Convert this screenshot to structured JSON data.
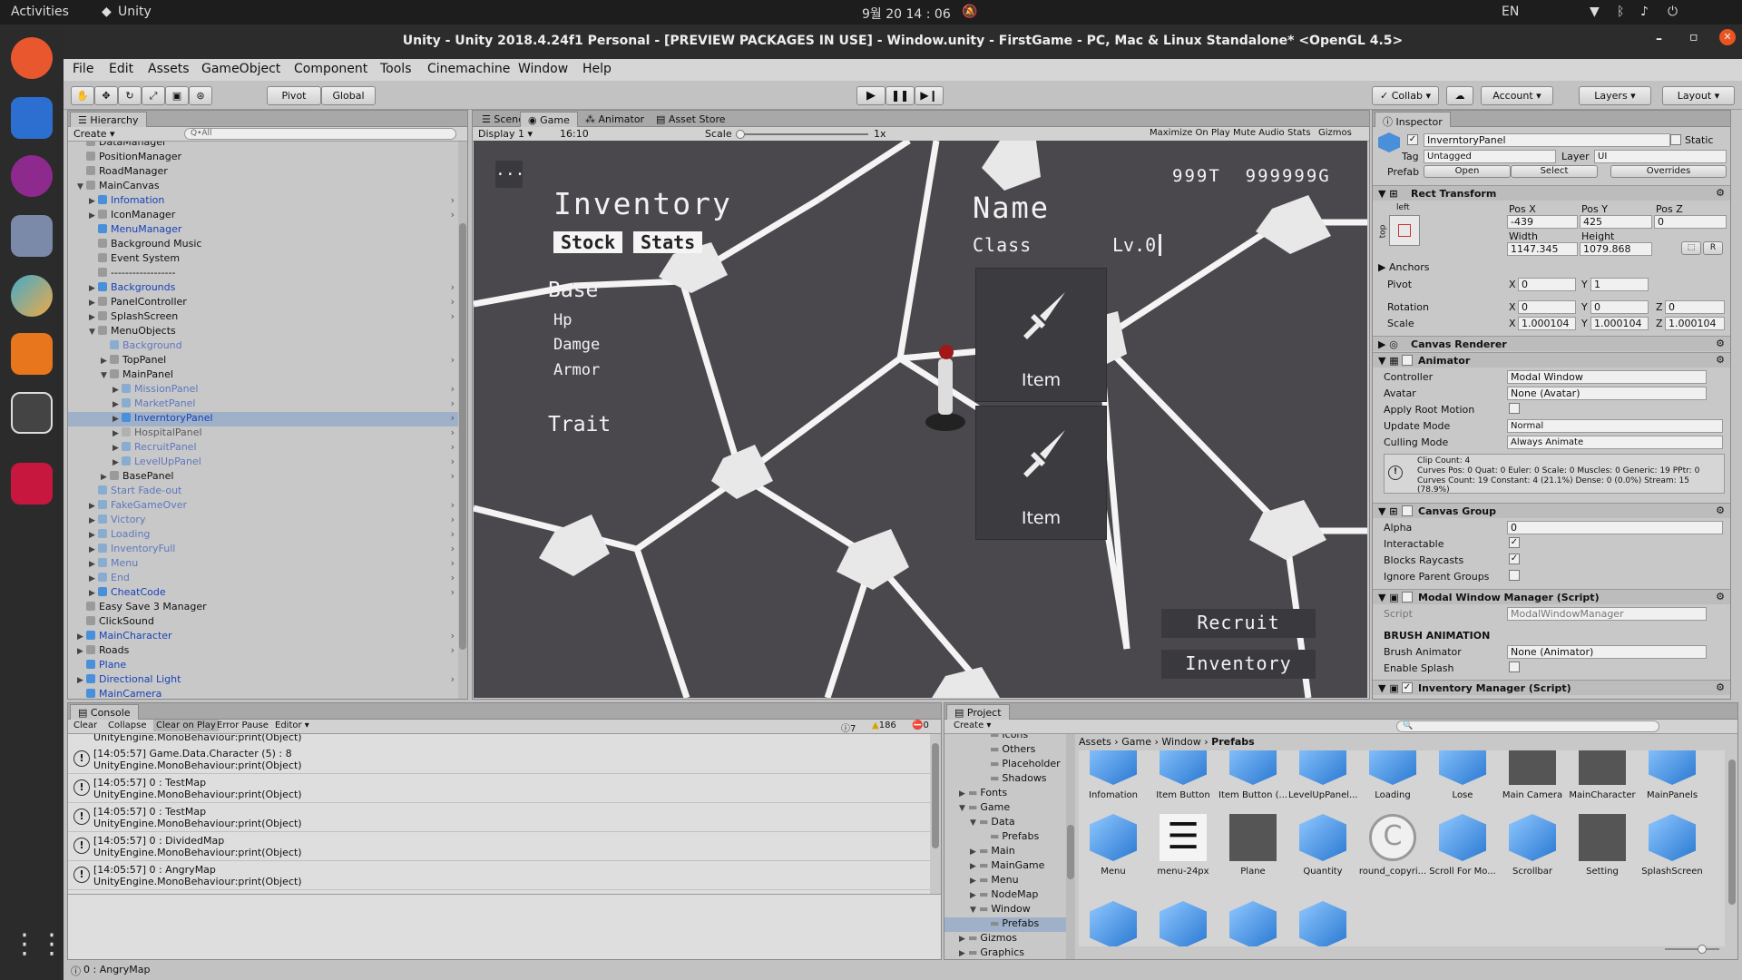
{
  "system": {
    "activities": "Activities",
    "app": "Unity",
    "clock": "9월 20  14 : 06",
    "lang": "EN"
  },
  "window": {
    "title": "Unity - Unity 2018.4.24f1 Personal - [PREVIEW PACKAGES IN USE] - Window.unity - FirstGame - PC, Mac & Linux Standalone* <OpenGL 4.5>"
  },
  "menu": [
    "File",
    "Edit",
    "Assets",
    "GameObject",
    "Component",
    "Tools",
    "Cinemachine",
    "Window",
    "Help"
  ],
  "toolbar": {
    "pivot": "Pivot",
    "global": "Global",
    "collab": "Collab",
    "account": "Account",
    "layers": "Layers",
    "layout": "Layout"
  },
  "hierarchy": {
    "tab": "Hierarchy",
    "create": "Create",
    "search": "Q•All",
    "items": [
      {
        "label": "DataManager",
        "indent": 1,
        "blue": false
      },
      {
        "label": "PositionManager",
        "indent": 1,
        "blue": false
      },
      {
        "label": "RoadManager",
        "indent": 1,
        "blue": false
      },
      {
        "label": "MainCanvas",
        "indent": 1,
        "blue": false,
        "open": true
      },
      {
        "label": "Infomation",
        "indent": 2,
        "blue": true,
        "arrow": true
      },
      {
        "label": "IconManager",
        "indent": 2,
        "blue": false,
        "arrow": true
      },
      {
        "label": "MenuManager",
        "indent": 2,
        "blue": true
      },
      {
        "label": "Background Music",
        "indent": 2,
        "blue": false
      },
      {
        "label": "Event System",
        "indent": 2,
        "blue": false
      },
      {
        "label": "------------------",
        "indent": 2,
        "blue": false
      },
      {
        "label": "Backgrounds",
        "indent": 2,
        "blue": true,
        "arrow": true
      },
      {
        "label": "PanelController",
        "indent": 2,
        "blue": false,
        "arrow": true
      },
      {
        "label": "SplashScreen",
        "indent": 2,
        "blue": false,
        "arrow": true
      },
      {
        "label": "MenuObjects",
        "indent": 2,
        "blue": false,
        "open": true
      },
      {
        "label": "Background",
        "indent": 3,
        "blue": true,
        "faded": true
      },
      {
        "label": "TopPanel",
        "indent": 3,
        "blue": false,
        "arrow": true
      },
      {
        "label": "MainPanel",
        "indent": 3,
        "blue": false,
        "open": true
      },
      {
        "label": "MissionPanel",
        "indent": 4,
        "blue": true,
        "faded": true,
        "arrow": true
      },
      {
        "label": "MarketPanel",
        "indent": 4,
        "blue": true,
        "faded": true,
        "arrow": true
      },
      {
        "label": "InverntoryPanel",
        "indent": 4,
        "blue": true,
        "selected": true,
        "arrow": true
      },
      {
        "label": "HospitalPanel",
        "indent": 4,
        "blue": false,
        "faded": true,
        "arrow": true
      },
      {
        "label": "RecruitPanel",
        "indent": 4,
        "blue": true,
        "faded": true,
        "arrow": true
      },
      {
        "label": "LevelUpPanel",
        "indent": 4,
        "blue": true,
        "faded": true,
        "arrow": true
      },
      {
        "label": "BasePanel",
        "indent": 3,
        "blue": false,
        "arrow": true
      },
      {
        "label": "Start Fade-out",
        "indent": 2,
        "blue": true,
        "faded": true
      },
      {
        "label": "FakeGameOver",
        "indent": 2,
        "blue": true,
        "faded": true,
        "arrow": true
      },
      {
        "label": "Victory",
        "indent": 2,
        "blue": true,
        "faded": true,
        "arrow": true
      },
      {
        "label": "Loading",
        "indent": 2,
        "blue": true,
        "faded": true,
        "arrow": true
      },
      {
        "label": "InventoryFull",
        "indent": 2,
        "blue": true,
        "faded": true,
        "arrow": true
      },
      {
        "label": "Menu",
        "indent": 2,
        "blue": true,
        "faded": true,
        "arrow": true
      },
      {
        "label": "End",
        "indent": 2,
        "blue": true,
        "faded": true,
        "arrow": true
      },
      {
        "label": "CheatCode",
        "indent": 2,
        "blue": true,
        "arrow": true
      },
      {
        "label": "Easy Save 3 Manager",
        "indent": 1,
        "blue": false
      },
      {
        "label": "ClickSound",
        "indent": 1,
        "blue": false
      },
      {
        "label": "MainCharacter",
        "indent": 1,
        "blue": true,
        "arrow": true
      },
      {
        "label": "Roads",
        "indent": 1,
        "blue": false,
        "arrow": true
      },
      {
        "label": "Plane",
        "indent": 1,
        "blue": true
      },
      {
        "label": "Directional Light",
        "indent": 1,
        "blue": true,
        "arrow": true
      },
      {
        "label": "MainCamera",
        "indent": 1,
        "blue": true
      }
    ]
  },
  "scene": {
    "tabs": [
      "Scene",
      "Game",
      "Animator",
      "Asset Store"
    ],
    "display": "Display 1",
    "aspect": "16:10",
    "scale_label": "Scale",
    "scale_value": "1x",
    "maximize": "Maximize On Play",
    "mute": "Mute Audio",
    "stats": "Stats",
    "gizmos": "Gizmos"
  },
  "game": {
    "menu": "...",
    "title": "Inventory",
    "stock": "Stock",
    "stats": "Stats",
    "base": "Base",
    "hp": "Hp",
    "damge": "Damge",
    "armor": "Armor",
    "trait": "Trait",
    "name": "Name",
    "class": "Class",
    "lv": "Lv.0",
    "currency": "999T  999999G",
    "item1": "Item",
    "item2": "Item",
    "recruit": "Recruit",
    "inventory": "Inventory"
  },
  "inspector": {
    "tab": "Inspector",
    "name": "InverntoryPanel",
    "static": "Static",
    "tag_label": "Tag",
    "tag": "Untagged",
    "layer_label": "Layer",
    "layer": "UI",
    "prefab": "Prefab",
    "open": "Open",
    "select": "Select",
    "overrides": "Overrides",
    "rect": {
      "title": "Rect Transform",
      "left": "left",
      "top": "top",
      "posx_l": "Pos X",
      "posy_l": "Pos Y",
      "posz_l": "Pos Z",
      "posx": "-439",
      "posy": "425",
      "posz": "0",
      "width_l": "Width",
      "height_l": "Height",
      "width": "1147.345",
      "height": "1079.868",
      "r": "R",
      "anchors": "Anchors",
      "pivot": "Pivot",
      "pivot_x": "0",
      "pivot_y": "1",
      "rotation": "Rotation",
      "rot_x": "0",
      "rot_y": "0",
      "rot_z": "0",
      "scale": "Scale",
      "sc_x": "1.000104",
      "sc_y": "1.000104",
      "sc_z": "1.000104",
      "x": "X",
      "y": "Y",
      "z": "Z"
    },
    "canvas_renderer": "Canvas Renderer",
    "animator": {
      "title": "Animator",
      "controller_l": "Controller",
      "controller": "Modal Window",
      "avatar_l": "Avatar",
      "avatar": "None (Avatar)",
      "root_l": "Apply Root Motion",
      "update_l": "Update Mode",
      "update": "Normal",
      "culling_l": "Culling Mode",
      "culling": "Always Animate",
      "info1": "Clip Count: 4",
      "info2": "Curves Pos: 0 Quat: 0 Euler: 0 Scale: 0 Muscles: 0 Generic: 19 PPtr: 0",
      "info3": "Curves Count: 19 Constant: 4 (21.1%) Dense: 0 (0.0%) Stream: 15 (78.9%)"
    },
    "canvas_group": {
      "title": "Canvas Group",
      "alpha_l": "Alpha",
      "alpha": "0",
      "interact_l": "Interactable",
      "blocks_l": "Blocks Raycasts",
      "ignore_l": "Ignore Parent Groups"
    },
    "modal": {
      "title": "Modal Window Manager (Script)",
      "script_l": "Script",
      "script": "ModalWindowManager",
      "brush": "BRUSH ANIMATION",
      "brush_anim_l": "Brush Animator",
      "brush_anim": "None (Animator)",
      "splash_l": "Enable Splash"
    },
    "inv_manager": "Inventory Manager (Script)"
  },
  "console": {
    "tab": "Console",
    "buttons": [
      "Clear",
      "Collapse",
      "Clear on Play",
      "Error Pause",
      "Editor"
    ],
    "count_info": "7",
    "count_warn": "186",
    "count_err": "0",
    "top": "UnityEngine.MonoBehaviour:print(Object)",
    "rows": [
      {
        "l1": "[14:05:57] Game.Data.Character (5) : 8",
        "l2": "UnityEngine.MonoBehaviour:print(Object)"
      },
      {
        "l1": "[14:05:57] 0 : TestMap",
        "l2": "UnityEngine.MonoBehaviour:print(Object)"
      },
      {
        "l1": "[14:05:57] 0 : TestMap",
        "l2": "UnityEngine.MonoBehaviour:print(Object)"
      },
      {
        "l1": "[14:05:57] 0 : DividedMap",
        "l2": "UnityEngine.MonoBehaviour:print(Object)"
      },
      {
        "l1": "[14:05:57] 0 : AngryMap",
        "l2": "UnityEngine.MonoBehaviour:print(Object)"
      }
    ],
    "status": "0 : AngryMap"
  },
  "project": {
    "tab": "Project",
    "create": "Create",
    "tree": [
      {
        "label": "Icons",
        "indent": 3
      },
      {
        "label": "Others",
        "indent": 3
      },
      {
        "label": "Placeholder",
        "indent": 3
      },
      {
        "label": "Shadows",
        "indent": 3
      },
      {
        "label": "Fonts",
        "indent": 1
      },
      {
        "label": "Game",
        "indent": 1,
        "open": true
      },
      {
        "label": "Data",
        "indent": 2,
        "open": true
      },
      {
        "label": "Prefabs",
        "indent": 3
      },
      {
        "label": "Main",
        "indent": 2
      },
      {
        "label": "MainGame",
        "indent": 2
      },
      {
        "label": "Menu",
        "indent": 2
      },
      {
        "label": "NodeMap",
        "indent": 2
      },
      {
        "label": "Window",
        "indent": 2,
        "open": true
      },
      {
        "label": "Prefabs",
        "indent": 3,
        "selected": true
      },
      {
        "label": "Gizmos",
        "indent": 1
      },
      {
        "label": "Graphics",
        "indent": 1
      }
    ],
    "breadcrumb": [
      "Assets",
      "Game",
      "Window",
      "Prefabs"
    ],
    "assets_row1": [
      "Infomation",
      "Item Button",
      "Item Button (...",
      "LevelUpPanel...",
      "Loading",
      "Lose",
      "Main Camera",
      "MainCharacter",
      "MainPanels"
    ],
    "assets_row2": [
      "Menu",
      "menu-24px",
      "Plane",
      "Quantity",
      "round_copyri...",
      "Scroll For Mo...",
      "Scrollbar",
      "Setting",
      "SplashScreen"
    ]
  }
}
